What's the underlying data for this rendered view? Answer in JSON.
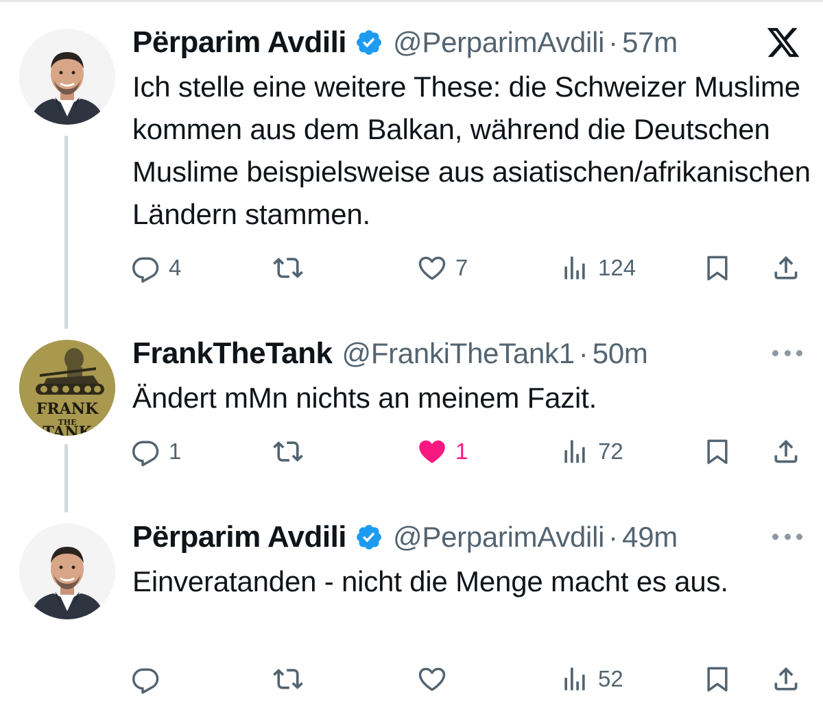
{
  "tweets": [
    {
      "name": "Përparim Avdili",
      "verified": true,
      "handle": "@PerparimAvdili",
      "separator": "·",
      "time": "57m",
      "text": "Ich stelle eine weitere These: die Schweizer Muslime kommen aus dem Balkan, während die Deutschen Muslime beispielsweise aus asiatischen/afrikanischen Ländern stammen.",
      "replies": "4",
      "reposts": "",
      "likes": "7",
      "liked": false,
      "views": "124"
    },
    {
      "name": "FrankTheTank",
      "verified": false,
      "handle": "@FrankiTheTank1",
      "separator": "·",
      "time": "50m",
      "text": "Ändert mMn nichts an meinem Fazit.",
      "replies": "1",
      "reposts": "",
      "likes": "1",
      "liked": true,
      "views": "72",
      "avatar_text": "FRANK THE TANK"
    },
    {
      "name": "Përparim Avdili",
      "verified": true,
      "handle": "@PerparimAvdili",
      "separator": "·",
      "time": "49m",
      "text": "Einveratanden - nicht die Menge macht es aus.",
      "replies": "",
      "reposts": "",
      "likes": "",
      "liked": false,
      "views": "52"
    }
  ],
  "colors": {
    "text": "#0f1419",
    "secondary": "#536471",
    "verified": "#1d9bf0",
    "like": "#f91880",
    "thread_line": "#cfd9de"
  },
  "icons": [
    "x-logo-icon",
    "verified-badge-icon",
    "reply-icon",
    "repost-icon",
    "like-icon",
    "views-icon",
    "bookmark-icon",
    "share-icon",
    "more-icon"
  ]
}
